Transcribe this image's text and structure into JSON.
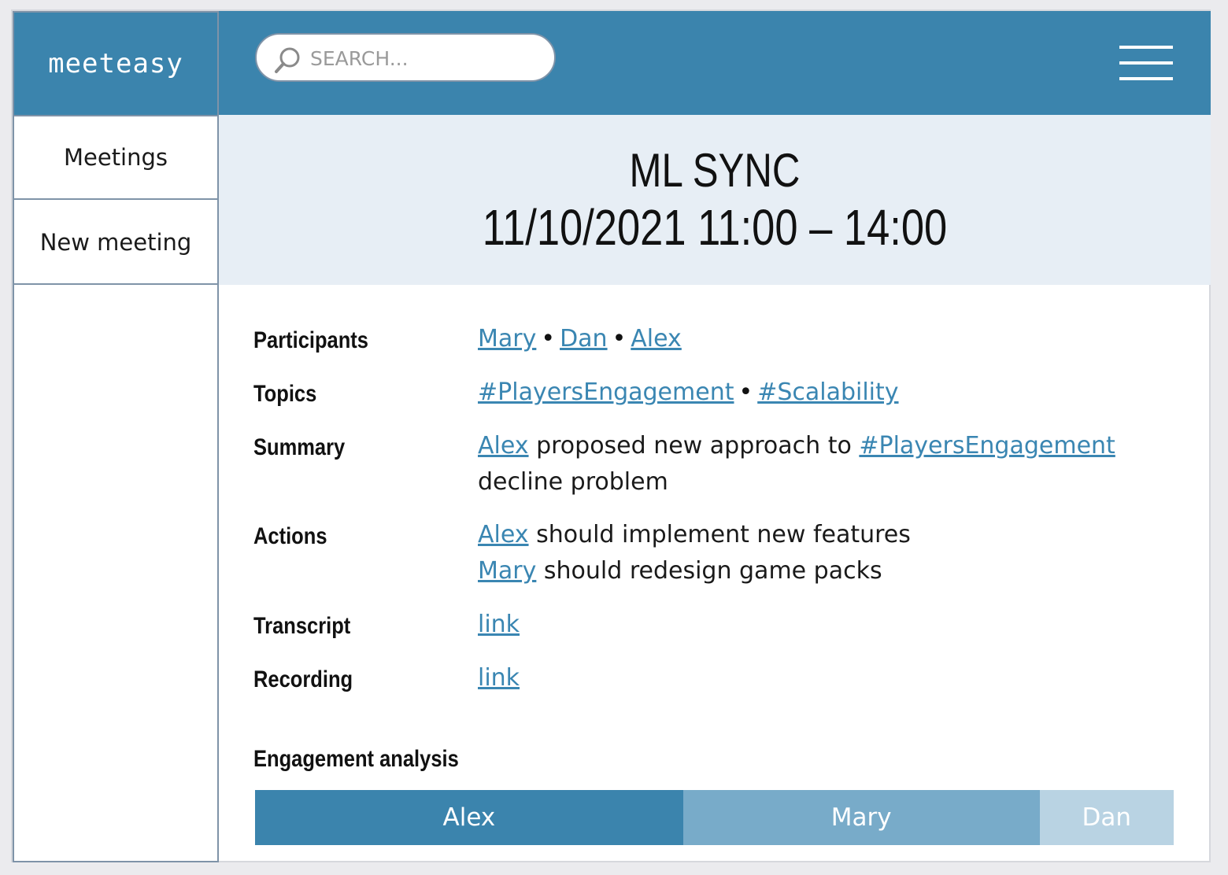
{
  "app": {
    "logo": "meeteasy"
  },
  "sidebar": {
    "items": [
      {
        "label": "Meetings"
      },
      {
        "label": "New meeting"
      }
    ]
  },
  "search": {
    "placeholder": "SEARCH..."
  },
  "icons": {
    "search": "search-icon",
    "menu": "hamburger-menu-icon"
  },
  "meeting": {
    "title": "ML SYNC",
    "datetime": "11/10/2021 11:00 – 14:00"
  },
  "details": {
    "participants": {
      "label": "Participants",
      "names": [
        "Mary",
        "Dan",
        "Alex"
      ],
      "separator": "•"
    },
    "topics": {
      "label": "Topics",
      "tags": [
        "#PlayersEngagement",
        "#Scalability"
      ]
    },
    "summary": {
      "label": "Summary",
      "person": "Alex",
      "text1": " proposed new approach to ",
      "tag": "#PlayersEngagement",
      "text2": "decline problem"
    },
    "actions": {
      "label": "Actions",
      "items": [
        {
          "person": "Alex",
          "text": " should implement new features"
        },
        {
          "person": "Mary",
          "text": " should redesign game packs"
        }
      ]
    },
    "transcript": {
      "label": "Transcript",
      "link": "link"
    },
    "recording": {
      "label": "Recording",
      "link": "link"
    }
  },
  "engagement": {
    "label": "Engagement analysis",
    "segments": [
      {
        "name": "Alex",
        "share": 0.466,
        "color": "#3b84ad"
      },
      {
        "name": "Mary",
        "share": 0.388,
        "color": "#78abc9"
      },
      {
        "name": "Dan",
        "share": 0.146,
        "color": "#b9d3e3"
      }
    ]
  }
}
